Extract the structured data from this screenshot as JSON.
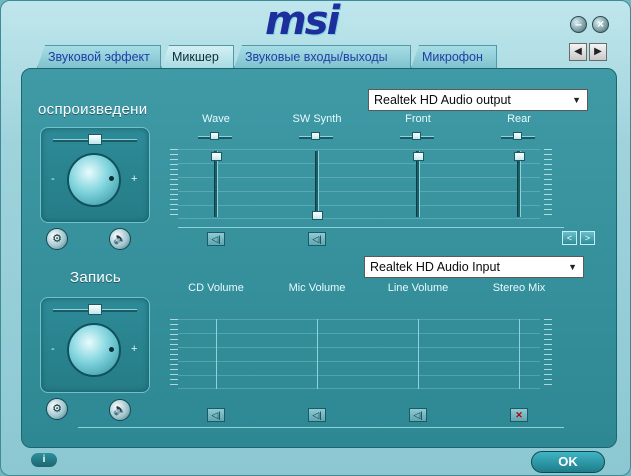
{
  "brand": {
    "logo_text": "msi"
  },
  "window_controls": {
    "minimize_glyph": "–",
    "close_glyph": "×"
  },
  "tabs": [
    {
      "label": "Звуковой эффект",
      "active": false
    },
    {
      "label": "Микшер",
      "active": true
    },
    {
      "label": "Звуковые входы/выходы",
      "active": false
    },
    {
      "label": "Микрофон",
      "active": false
    }
  ],
  "tab_scroll": {
    "left": "◀",
    "right": "▶"
  },
  "playback": {
    "title": "оспроизведени",
    "device": "Realtek HD Audio output",
    "knob": {
      "minus": "-",
      "plus": "+"
    },
    "icons": {
      "settings": "⚙",
      "speaker": "🔈"
    },
    "channels": [
      {
        "label": "Wave",
        "level": 0.95,
        "balance": 0.5,
        "muted": false
      },
      {
        "label": "SW Synth",
        "level": 0.0,
        "balance": 0.5,
        "muted": false
      },
      {
        "label": "Front",
        "level": 0.95,
        "balance": 0.5,
        "muted": false
      },
      {
        "label": "Rear",
        "level": 0.95,
        "balance": 0.5,
        "muted": false
      }
    ],
    "nav": {
      "prev": "<",
      "next": ">"
    }
  },
  "recording": {
    "title": "Запись",
    "device": "Realtek HD Audio Input",
    "knob": {
      "minus": "-",
      "plus": "+"
    },
    "icons": {
      "settings": "⚙",
      "speaker": "🔈"
    },
    "channels": [
      {
        "label": "CD Volume",
        "muted": false
      },
      {
        "label": "Mic Volume",
        "muted": false
      },
      {
        "label": "Line Volume",
        "muted": false
      },
      {
        "label": "Stereo Mix",
        "muted": true
      }
    ]
  },
  "footer": {
    "info_label": "i",
    "ok_label": "OK"
  }
}
